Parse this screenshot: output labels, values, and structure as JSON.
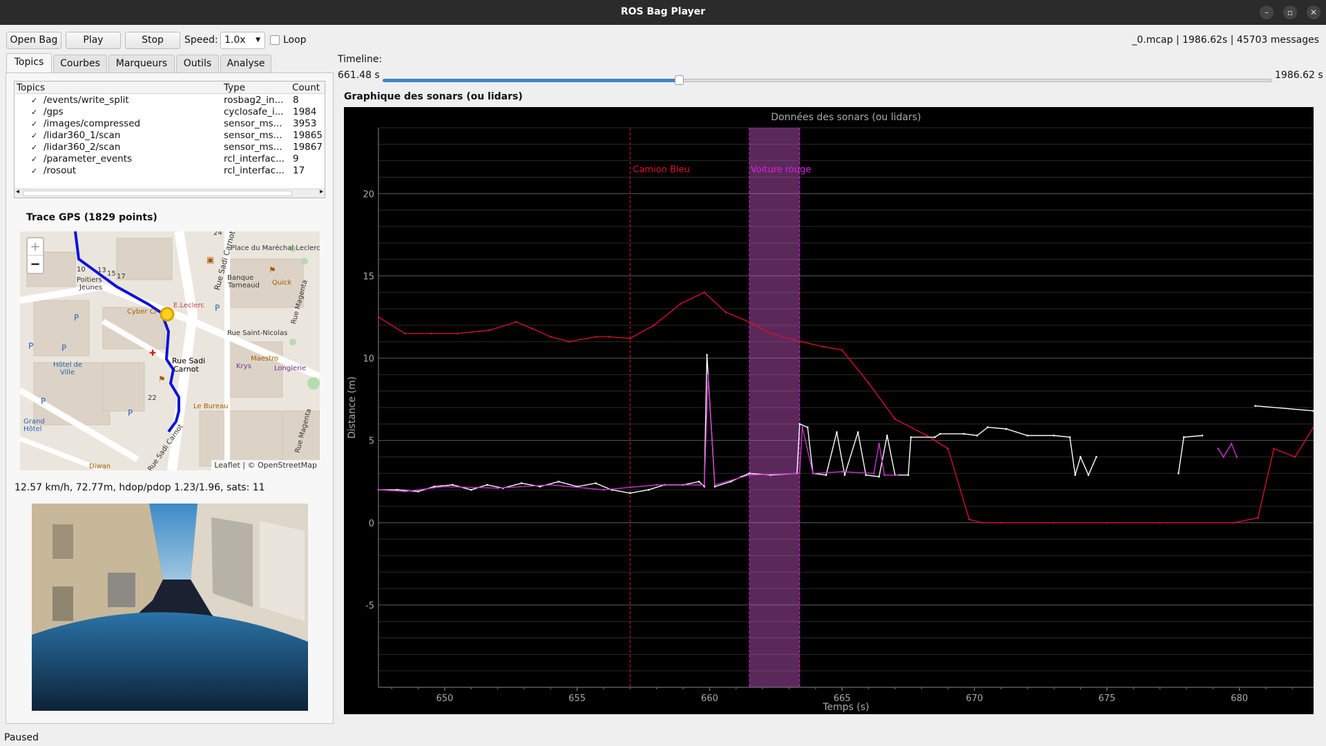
{
  "window": {
    "title": "ROS Bag Player",
    "controls": [
      "–",
      "▫",
      "✕"
    ]
  },
  "toolbar": {
    "open_label": "Open Bag",
    "play_label": "Play",
    "stop_label": "Stop",
    "speed_label": "Speed:",
    "speed_value": "1.0x",
    "loop_label": "Loop",
    "file_info": "_0.mcap | 1986.62s | 45703 messages"
  },
  "tabs": [
    "Topics",
    "Courbes",
    "Marqueurs",
    "Outils",
    "Analyse"
  ],
  "topics": {
    "headers": {
      "topic": "Topics",
      "type": "Type",
      "count": "Count"
    },
    "rows": [
      {
        "checked": true,
        "topic": "/events/write_split",
        "type": "rosbag2_in...",
        "count": "8"
      },
      {
        "checked": true,
        "topic": "/gps",
        "type": "cyclosafe_i...",
        "count": "1984"
      },
      {
        "checked": true,
        "topic": "/images/compressed",
        "type": "sensor_ms...",
        "count": "3953"
      },
      {
        "checked": true,
        "topic": "/lidar360_1/scan",
        "type": "sensor_ms...",
        "count": "19865"
      },
      {
        "checked": true,
        "topic": "/lidar360_2/scan",
        "type": "sensor_ms...",
        "count": "19867"
      },
      {
        "checked": true,
        "topic": "/parameter_events",
        "type": "rcl_interfac...",
        "count": "9"
      },
      {
        "checked": true,
        "topic": "/rosout",
        "type": "rcl_interfac...",
        "count": "17"
      }
    ]
  },
  "gps": {
    "title": "Trace GPS (1829 points)",
    "status": "12.57 km/h, 72.77m, hdop/pdop 1.23/1.96, sats: 11",
    "attribution": "Leaflet | © OpenStreetMap",
    "zoom_in": "+",
    "zoom_out": "−",
    "labels": [
      "Place du Maréchal Leclerc",
      "Rue Sadi Carnot",
      "Banque Tarneaud",
      "Quick",
      "Rue Saint-Nicolas",
      "Maestro",
      "Krys",
      "Longlerie",
      "Rue Sadi Carnot",
      "Hôtel de Ville",
      "Grand Hôtel",
      "Le Bureau",
      "Rue Magenta",
      "Cyber Cr",
      "E.Leclerc",
      "Diwan",
      "Poitiers Jeunes",
      "24",
      "22",
      "15",
      "17",
      "13",
      "10"
    ]
  },
  "timeline": {
    "label": "Timeline:",
    "current": "661.48 s",
    "end": "1986.62 s",
    "fraction": 0.333
  },
  "plot": {
    "section_title": "Graphique des sonars (ou lidars)"
  },
  "status": "Paused",
  "chart_data": {
    "type": "line",
    "title": "Données des sonars (ou lidars)",
    "xlabel": "Temps (s)",
    "ylabel": "Distance (m)",
    "xlim": [
      647.5,
      682.8
    ],
    "ylim": [
      -10,
      24
    ],
    "xticks": [
      650,
      655,
      660,
      665,
      670,
      675,
      680
    ],
    "yticks": [
      20,
      15,
      10,
      5,
      0,
      -5
    ],
    "grid": true,
    "markers": [
      {
        "label": "Camion Bleu",
        "x": 657.0,
        "color": "#e0102a"
      },
      {
        "label": "Voiture rouge",
        "x_start": 661.5,
        "x_end": 663.4,
        "color": "#e020e0"
      }
    ],
    "series": [
      {
        "color": "#d4102a",
        "points": [
          [
            647.5,
            12.5
          ],
          [
            648.5,
            11.5
          ],
          [
            649.5,
            11.5
          ],
          [
            650.5,
            11.5
          ],
          [
            651.7,
            11.7
          ],
          [
            652.7,
            12.2
          ],
          [
            653.3,
            11.8
          ],
          [
            654.0,
            11.3
          ],
          [
            654.7,
            11.0
          ],
          [
            655.7,
            11.3
          ],
          [
            656.2,
            11.3
          ],
          [
            657.0,
            11.2
          ],
          [
            657.9,
            12.0
          ],
          [
            658.9,
            13.3
          ],
          [
            659.8,
            14.0
          ],
          [
            660.6,
            12.8
          ],
          [
            661.5,
            12.2
          ],
          [
            662.3,
            11.5
          ],
          [
            663.2,
            11.1
          ],
          [
            664.3,
            10.7
          ],
          [
            665.0,
            10.5
          ],
          [
            666.0,
            8.5
          ],
          [
            667.0,
            6.3
          ],
          [
            668.2,
            5.3
          ],
          [
            669.0,
            4.5
          ],
          [
            669.8,
            0.2
          ],
          [
            670.3,
            0
          ],
          [
            671,
            0
          ],
          [
            673,
            0
          ],
          [
            675,
            0
          ],
          [
            677,
            0
          ],
          [
            679.8,
            0
          ],
          [
            680.7,
            0.3
          ],
          [
            681.3,
            4.5
          ],
          [
            682.1,
            4.0
          ],
          [
            682.8,
            5.8
          ]
        ]
      },
      {
        "color": "#ffffff",
        "points": [
          [
            647.5,
            2.0
          ],
          [
            648.2,
            2.0
          ],
          [
            649.0,
            1.9
          ],
          [
            649.6,
            2.2
          ],
          [
            650.3,
            2.3
          ],
          [
            651.0,
            2.0
          ],
          [
            651.6,
            2.3
          ],
          [
            652.2,
            2.1
          ],
          [
            652.9,
            2.4
          ],
          [
            653.6,
            2.2
          ],
          [
            654.3,
            2.5
          ],
          [
            655.0,
            2.2
          ],
          [
            655.7,
            2.4
          ],
          [
            656.3,
            2.0
          ],
          [
            657.0,
            1.8
          ],
          [
            657.7,
            2.0
          ],
          [
            658.3,
            2.3
          ],
          [
            659.0,
            2.3
          ],
          [
            659.6,
            2.5
          ],
          [
            659.8,
            2.2
          ],
          [
            659.9,
            10.2
          ],
          [
            660.2,
            2.2
          ],
          [
            660.8,
            2.5
          ],
          [
            661.2,
            2.8
          ],
          [
            661.5,
            3.0
          ],
          [
            662.3,
            2.9
          ],
          [
            663.3,
            3.0
          ],
          [
            663.4,
            6.0
          ],
          [
            663.7,
            5.8
          ],
          [
            663.9,
            3.0
          ],
          [
            664.4,
            2.9
          ],
          [
            664.8,
            5.5
          ],
          [
            665.1,
            2.9
          ],
          [
            665.6,
            5.5
          ],
          [
            665.9,
            2.9
          ],
          [
            666.4,
            2.8
          ],
          [
            666.7,
            5.3
          ],
          [
            667.0,
            2.9
          ],
          [
            667.5,
            2.9
          ],
          [
            667.6,
            5.2
          ],
          [
            668.5,
            5.2
          ],
          [
            668.7,
            5.4
          ],
          [
            669.6,
            5.4
          ],
          [
            670.1,
            5.3
          ],
          [
            670.5,
            5.8
          ],
          [
            671.2,
            5.7
          ],
          [
            672.0,
            5.3
          ],
          [
            673.0,
            5.3
          ],
          [
            673.6,
            5.2
          ],
          [
            673.8,
            2.9
          ],
          [
            674.0,
            4.0
          ],
          [
            674.3,
            2.9
          ],
          [
            674.6,
            4.0
          ]
        ]
      },
      {
        "color": "#cc33cc",
        "points": [
          [
            647.5,
            2.0
          ],
          [
            648.5,
            1.9
          ],
          [
            650,
            2.2
          ],
          [
            652,
            2.1
          ],
          [
            654,
            2.3
          ],
          [
            656,
            2.0
          ],
          [
            658,
            2.3
          ],
          [
            659.8,
            2.3
          ],
          [
            659.95,
            9.0
          ],
          [
            660.2,
            2.3
          ],
          [
            661.5,
            2.9
          ],
          [
            663.4,
            3.0
          ],
          [
            663.5,
            5.8
          ],
          [
            663.9,
            3.0
          ],
          [
            665,
            3.1
          ],
          [
            666.2,
            3.0
          ],
          [
            666.4,
            4.8
          ],
          [
            666.6,
            2.9
          ],
          [
            667.1,
            2.9
          ]
        ]
      },
      {
        "color": "#ffffff",
        "points": [
          [
            677.7,
            3.0
          ],
          [
            677.9,
            5.2
          ],
          [
            678.6,
            5.3
          ]
        ]
      },
      {
        "color": "#cc33cc",
        "points": [
          [
            679.2,
            4.5
          ],
          [
            679.4,
            4.0
          ],
          [
            679.7,
            4.8
          ],
          [
            679.9,
            4.0
          ]
        ]
      },
      {
        "color": "#ffffff",
        "points": [
          [
            680.6,
            7.1
          ],
          [
            682.8,
            6.8
          ]
        ]
      }
    ]
  }
}
